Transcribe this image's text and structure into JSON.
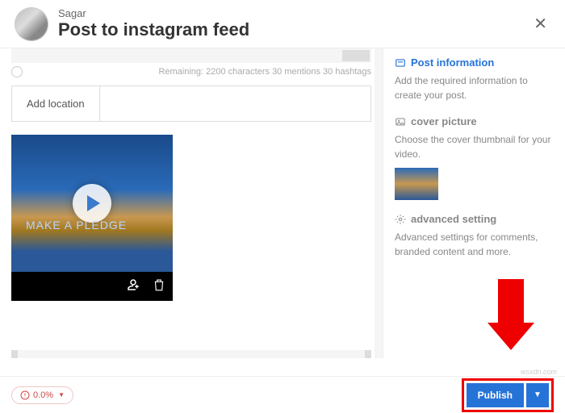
{
  "header": {
    "user": "Sagar",
    "title": "Post to instagram feed"
  },
  "composer": {
    "remaining": "Remaining: 2200 characters 30 mentions 30 hashtags",
    "add_location": "Add location",
    "media_label": "MAKE A PLEDGE"
  },
  "sidebar": {
    "info": {
      "title": "Post information",
      "desc": "Add the required information to create your post."
    },
    "cover": {
      "title": "cover picture",
      "desc": "Choose the cover thumbnail for your video."
    },
    "adv": {
      "title": "advanced setting",
      "desc": "Advanced settings for comments, branded content and more."
    }
  },
  "footer": {
    "badge": "0.0%",
    "publish": "Publish"
  },
  "watermark": "wsxdn.com"
}
